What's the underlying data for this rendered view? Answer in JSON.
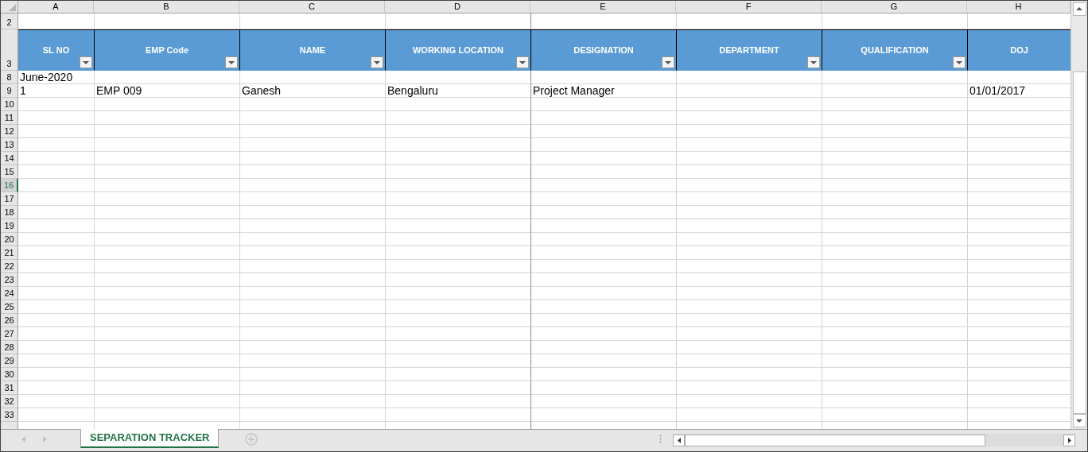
{
  "columns": [
    {
      "letter": "A",
      "header": "SL NO",
      "filter": true
    },
    {
      "letter": "B",
      "header": "EMP Code",
      "filter": true
    },
    {
      "letter": "C",
      "header": "NAME",
      "filter": true
    },
    {
      "letter": "D",
      "header": "WORKING LOCATION",
      "filter": true
    },
    {
      "letter": "E",
      "header": "DESIGNATION",
      "filter": true
    },
    {
      "letter": "F",
      "header": "DEPARTMENT",
      "filter": true
    },
    {
      "letter": "G",
      "header": "QUALIFICATION",
      "filter": true
    },
    {
      "letter": "H",
      "header": "DOJ",
      "filter": false
    }
  ],
  "rows": [
    {
      "number": "2",
      "kind": "blank",
      "selected": false
    },
    {
      "number": "3",
      "kind": "header",
      "selected": false
    },
    {
      "number": "8",
      "kind": "data",
      "selected": false,
      "cells": [
        "June-2020"
      ]
    },
    {
      "number": "9",
      "kind": "data",
      "selected": false,
      "cells": [
        "1",
        "EMP  009",
        "Ganesh",
        "Bengaluru",
        "Project Manager",
        "",
        "",
        "01/01/2017"
      ]
    },
    {
      "number": "10",
      "kind": "data",
      "selected": false
    },
    {
      "number": "11",
      "kind": "data",
      "selected": false
    },
    {
      "number": "12",
      "kind": "data",
      "selected": false
    },
    {
      "number": "13",
      "kind": "data",
      "selected": false
    },
    {
      "number": "14",
      "kind": "data",
      "selected": false
    },
    {
      "number": "15",
      "kind": "data",
      "selected": false
    },
    {
      "number": "16",
      "kind": "data",
      "selected": true
    },
    {
      "number": "17",
      "kind": "data",
      "selected": false
    },
    {
      "number": "18",
      "kind": "data",
      "selected": false
    },
    {
      "number": "19",
      "kind": "data",
      "selected": false
    },
    {
      "number": "20",
      "kind": "data",
      "selected": false
    },
    {
      "number": "21",
      "kind": "data",
      "selected": false
    },
    {
      "number": "22",
      "kind": "data",
      "selected": false
    },
    {
      "number": "23",
      "kind": "data",
      "selected": false
    },
    {
      "number": "24",
      "kind": "data",
      "selected": false
    },
    {
      "number": "25",
      "kind": "data",
      "selected": false
    },
    {
      "number": "26",
      "kind": "data",
      "selected": false
    },
    {
      "number": "27",
      "kind": "data",
      "selected": false
    },
    {
      "number": "28",
      "kind": "data",
      "selected": false
    },
    {
      "number": "29",
      "kind": "data",
      "selected": false
    },
    {
      "number": "30",
      "kind": "data",
      "selected": false
    },
    {
      "number": "31",
      "kind": "data",
      "selected": false
    },
    {
      "number": "32",
      "kind": "data",
      "selected": false
    },
    {
      "number": "33",
      "kind": "data",
      "selected": false
    }
  ],
  "sheet_tabs": [
    {
      "label": "SEPARATION TRACKER",
      "selected": true
    }
  ]
}
